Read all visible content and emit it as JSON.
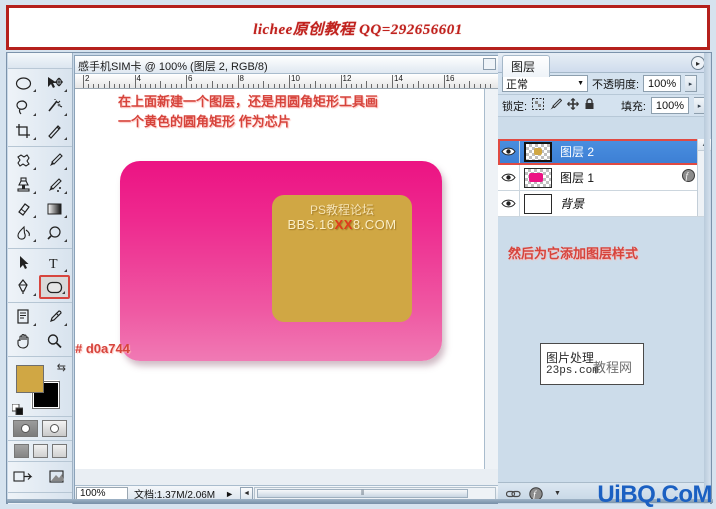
{
  "banner": {
    "text": "lichee原创教程 QQ=292656601",
    "border_color": "#b5201c",
    "text_color": "#c0221e"
  },
  "document_window": {
    "title": "感手机SIM卡 @ 100% (图层 2, RGB/8)",
    "ruler_labels": [
      "2",
      "4",
      "6",
      "8",
      "10",
      "12",
      "14",
      "16"
    ],
    "canvas": {
      "annotation": "在上面新建一个图层，还是用圆角矩形工具画\n一个黄色的圆角矩形 作为芯片",
      "hex_label": "# d0a744",
      "card_color_top": "#ec1383",
      "card_color_bottom": "#f07ab4",
      "chip_color": "#d0a744",
      "chip_line1": "PS教程论坛",
      "chip_line2_pre": "BBS.16",
      "chip_line2_xx": "XX",
      "chip_line2_post": "8.COM"
    },
    "status": {
      "zoom": "100%",
      "doc_size": "文档:1.37M/2.06M",
      "scroll_arrow_left": "◄",
      "scroll_arrow_right": "►",
      "menu_arrow": "►"
    }
  },
  "toolbar": {
    "tools": [
      {
        "name": "elliptical-marquee-tool",
        "glyph": "ellipse",
        "selected": false
      },
      {
        "name": "move-tool",
        "glyph": "move",
        "selected": false
      },
      {
        "name": "lasso-tool",
        "glyph": "lasso",
        "selected": false
      },
      {
        "name": "magic-wand-tool",
        "glyph": "wand",
        "selected": false
      },
      {
        "name": "crop-tool",
        "glyph": "crop",
        "selected": false
      },
      {
        "name": "slice-tool",
        "glyph": "slice",
        "selected": false
      },
      {
        "name": "patch-tool",
        "glyph": "patch",
        "selected": false
      },
      {
        "name": "brush-tool",
        "glyph": "brush",
        "selected": false
      },
      {
        "name": "clone-stamp-tool",
        "glyph": "stamp",
        "selected": false
      },
      {
        "name": "history-brush-tool",
        "glyph": "historybrush",
        "selected": false
      },
      {
        "name": "eraser-tool",
        "glyph": "eraser",
        "selected": false
      },
      {
        "name": "gradient-tool",
        "glyph": "gradient",
        "selected": false
      },
      {
        "name": "blur-tool",
        "glyph": "blur",
        "selected": false
      },
      {
        "name": "dodge-tool",
        "glyph": "dodge",
        "selected": false
      },
      {
        "name": "path-selection-tool",
        "glyph": "arrow",
        "selected": false
      },
      {
        "name": "type-tool",
        "glyph": "type",
        "selected": false
      },
      {
        "name": "pen-tool",
        "glyph": "pen",
        "selected": false
      },
      {
        "name": "rounded-rectangle-tool",
        "glyph": "roundrect",
        "selected": true
      },
      {
        "name": "notes-tool",
        "glyph": "notes",
        "selected": false
      },
      {
        "name": "eyedropper-tool",
        "glyph": "eyedropper",
        "selected": false
      },
      {
        "name": "hand-tool",
        "glyph": "hand",
        "selected": false
      },
      {
        "name": "zoom-tool",
        "glyph": "zoom",
        "selected": false
      }
    ],
    "foreground_color": "#d0a744",
    "background_color": "#000000"
  },
  "layers_panel": {
    "tab_label": "图层",
    "blend_mode": "正常",
    "opacity_label": "不透明度:",
    "opacity_value": "100%",
    "lock_label": "锁定:",
    "fill_label": "填充:",
    "fill_value": "100%",
    "lock_icons": [
      "lock-transparency-icon",
      "lock-pixels-icon",
      "lock-position-icon",
      "lock-all-icon"
    ],
    "layers": [
      {
        "name": "图层 2",
        "selected": true,
        "visible": true,
        "thumb": "chip",
        "has_fx": false,
        "locked": false
      },
      {
        "name": "图层 1",
        "selected": false,
        "visible": true,
        "thumb": "card",
        "has_fx": true,
        "locked": false
      },
      {
        "name": "背景",
        "selected": false,
        "visible": true,
        "thumb": "white",
        "has_fx": false,
        "locked": true
      }
    ]
  },
  "right_notes": {
    "note": "然后为它添加图层样式",
    "watermark_line1": "图片处理",
    "watermark_line2": "23ps.com",
    "watermark_line3": "教程网"
  },
  "footer": {
    "watermark": "UiBQ.CoM",
    "watermark_color": "#1b60c2"
  }
}
